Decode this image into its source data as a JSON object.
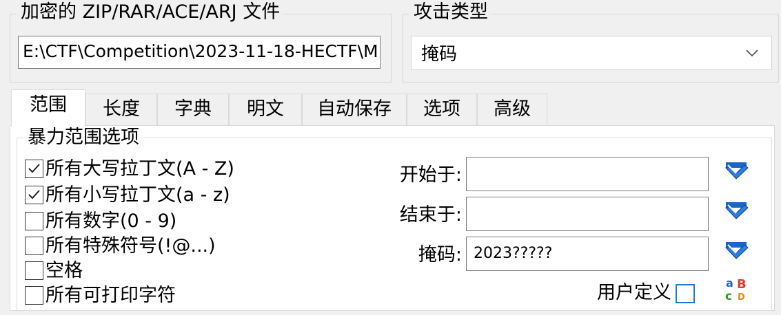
{
  "encrypted_file": {
    "group_label": "加密的 ZIP/RAR/ACE/ARJ 文件",
    "path_value": "E:\\CTF\\Competition\\2023-11-18-HECTF\\M"
  },
  "attack_type": {
    "group_label": "攻击类型",
    "selected": "掩码"
  },
  "tabs": [
    {
      "label": "范围",
      "active": true
    },
    {
      "label": "长度"
    },
    {
      "label": "字典"
    },
    {
      "label": "明文"
    },
    {
      "label": "自动保存"
    },
    {
      "label": "选项"
    },
    {
      "label": "高级"
    }
  ],
  "brute_range": {
    "group_label": "暴力范围选项",
    "checkboxes": [
      {
        "label": "所有大写拉丁文(A - Z)",
        "checked": true
      },
      {
        "label": "所有小写拉丁文(a - z)",
        "checked": true
      },
      {
        "label": "所有数字(0 - 9)",
        "checked": false
      },
      {
        "label": "所有特殊符号(!@...)",
        "checked": false
      },
      {
        "label": "空格",
        "checked": false
      },
      {
        "label": "所有可打印字符",
        "checked": false
      }
    ],
    "start_label": "开始于:",
    "start_value": "",
    "end_label": "结束于:",
    "end_value": "",
    "mask_label": "掩码:",
    "mask_value": "2023?????",
    "user_defined_label": "用户定义"
  },
  "icons": {
    "field_buttons": "eraser-icon",
    "charset": "charset-abcd-icon"
  }
}
